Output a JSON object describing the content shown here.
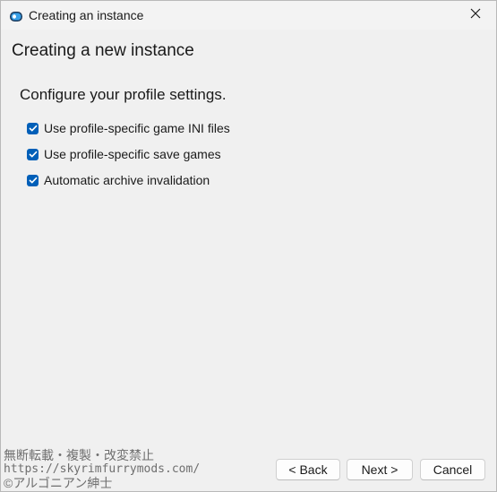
{
  "window": {
    "title": "Creating an instance"
  },
  "page": {
    "heading": "Creating a new instance",
    "subheading": "Configure your profile settings."
  },
  "options": [
    {
      "label": "Use profile-specific game INI files",
      "checked": true
    },
    {
      "label": "Use profile-specific save games",
      "checked": true
    },
    {
      "label": "Automatic archive invalidation",
      "checked": true
    }
  ],
  "buttons": {
    "back": "< Back",
    "next": "Next >",
    "cancel": "Cancel"
  },
  "watermark": {
    "line1": "無断転載・複製・改変禁止",
    "line2": "https://skyrimfurrymods.com/",
    "line3": "©アルゴニアン紳士"
  },
  "colors": {
    "accent": "#005fb8",
    "background": "#f0f0f0"
  },
  "icons": {
    "app": "app-logo-icon",
    "close": "close-icon",
    "check": "checkmark-icon"
  }
}
